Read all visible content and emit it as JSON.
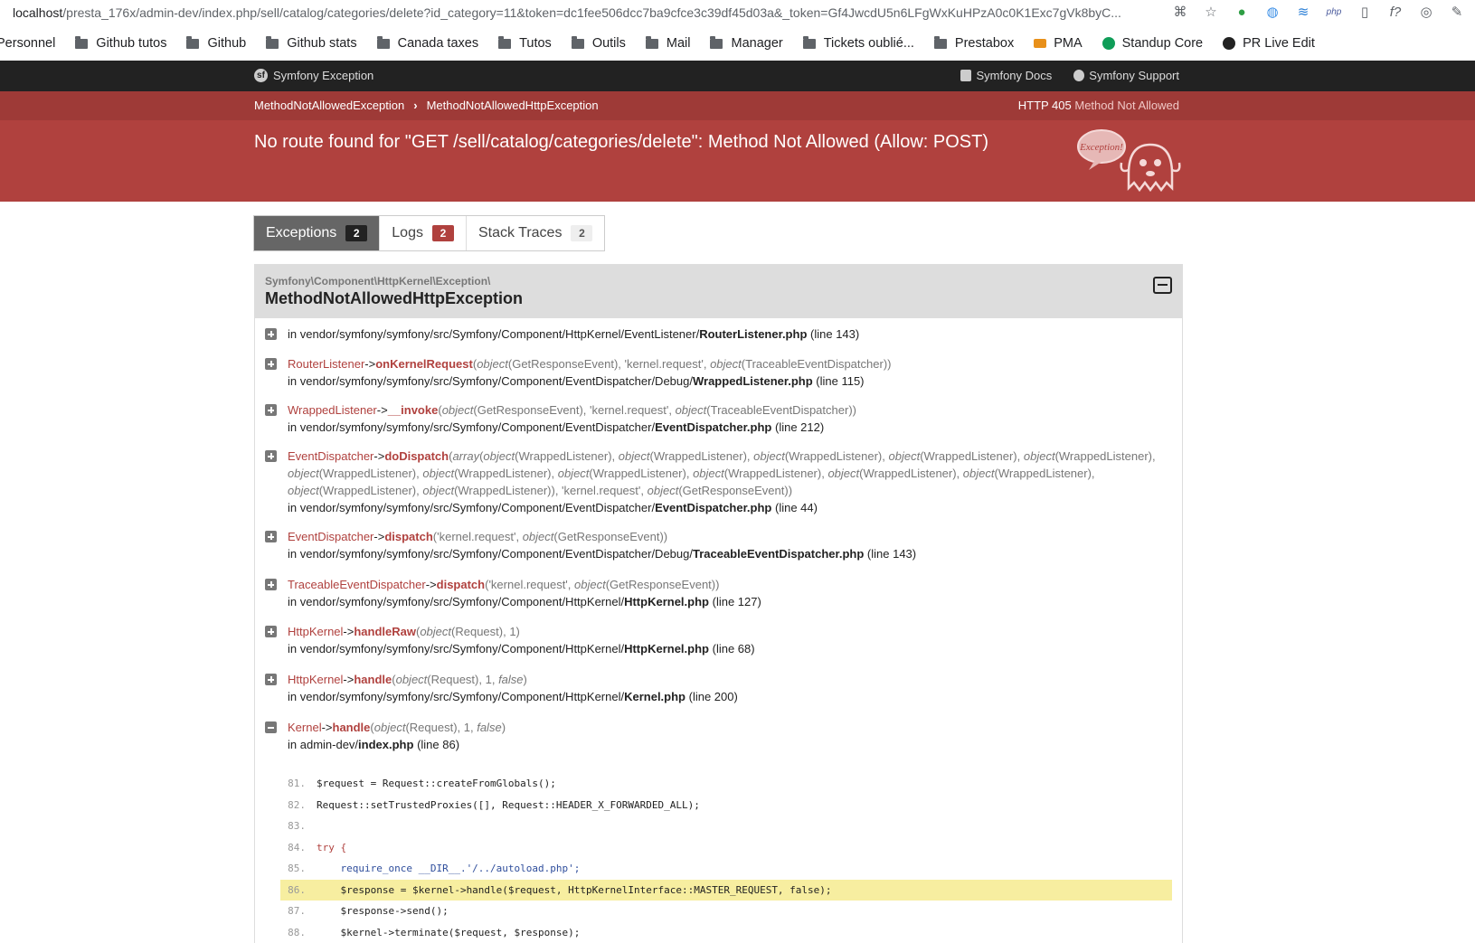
{
  "browser": {
    "url_host": "localhost",
    "url_rest": "/presta_176x/admin-dev/index.php/sell/catalog/categories/delete?id_category=11&token=dc1fee506dcc7ba9cfce3c39df45d03a&_token=Gf4JwcdU5n6LFgWxKuHPzA0c0K1Exc7gVk8byC...",
    "bookmarks": [
      "Personnel",
      "Github tutos",
      "Github",
      "Github stats",
      "Canada taxes",
      "Tutos",
      "Outils",
      "Mail",
      "Manager",
      "Tickets oublié...",
      "Prestabox",
      "PMA",
      "Standup Core",
      "PR Live Edit"
    ]
  },
  "header": {
    "brand": "Symfony Exception",
    "docs": "Symfony Docs",
    "support": "Symfony Support"
  },
  "band": {
    "crumb1": "MethodNotAllowedException",
    "crumb2": "MethodNotAllowedHttpException",
    "status_code": "HTTP 405",
    "status_text": "Method Not Allowed",
    "message": "No route found for \"GET /sell/catalog/categories/delete\": Method Not Allowed (Allow: POST)",
    "ghost_label": "Exception!"
  },
  "tabs": [
    {
      "label": "Exceptions",
      "count": "2"
    },
    {
      "label": "Logs",
      "count": "2"
    },
    {
      "label": "Stack Traces",
      "count": "2"
    }
  ],
  "exception": {
    "namespace": "Symfony\\Component\\HttpKernel\\Exception\\",
    "class": "MethodNotAllowedHttpException"
  },
  "frames": {
    "f0_file": "in vendor/symfony/symfony/src/Symfony/Component/HttpKernel/EventListener/",
    "f0_fileb": "RouterListener.php",
    "f0_line": "(line 143)",
    "f1_class": "RouterListener",
    "f1_method": "onKernelRequest",
    "f1_file": "in vendor/symfony/symfony/src/Symfony/Component/EventDispatcher/Debug/",
    "f1_fileb": "WrappedListener.php",
    "f1_line": "(line 115)",
    "f2_class": "WrappedListener",
    "f2_method": "__invoke",
    "f2_file": "in vendor/symfony/symfony/src/Symfony/Component/EventDispatcher/",
    "f2_fileb": "EventDispatcher.php",
    "f2_line": "(line 212)",
    "f3_class": "EventDispatcher",
    "f3_method": "doDispatch",
    "f3_file": "in vendor/symfony/symfony/src/Symfony/Component/EventDispatcher/",
    "f3_fileb": "EventDispatcher.php",
    "f3_line": "(line 44)",
    "f4_class": "EventDispatcher",
    "f4_method": "dispatch",
    "f4_file": "in vendor/symfony/symfony/src/Symfony/Component/EventDispatcher/Debug/",
    "f4_fileb": "TraceableEventDispatcher.php",
    "f4_line": "(line 143)",
    "f5_class": "TraceableEventDispatcher",
    "f5_method": "dispatch",
    "f5_file": "in vendor/symfony/symfony/src/Symfony/Component/HttpKernel/",
    "f5_fileb": "HttpKernel.php",
    "f5_line": "(line 127)",
    "f6_class": "HttpKernel",
    "f6_method": "handleRaw",
    "f6_file": "in vendor/symfony/symfony/src/Symfony/Component/HttpKernel/",
    "f6_fileb": "HttpKernel.php",
    "f6_line": "(line 68)",
    "f7_class": "HttpKernel",
    "f7_method": "handle",
    "f7_file": "in vendor/symfony/symfony/src/Symfony/Component/HttpKernel/",
    "f7_fileb": "Kernel.php",
    "f7_line": "(line 200)",
    "f8_class": "Kernel",
    "f8_method": "handle",
    "f8_file": "in admin-dev/",
    "f8_fileb": "index.php",
    "f8_line": "(line 86)"
  },
  "code_lines": [
    {
      "n": "81.",
      "t": "$request = Request::createFromGlobals();"
    },
    {
      "n": "82.",
      "t": "Request::setTrustedProxies([], Request::HEADER_X_FORWARDED_ALL);"
    },
    {
      "n": "83.",
      "t": ""
    },
    {
      "n": "84.",
      "t": "try {"
    },
    {
      "n": "85.",
      "t": "    require_once __DIR__.'/../autoload.php';"
    },
    {
      "n": "86.",
      "t": "    $response = $kernel->handle($request, HttpKernelInterface::MASTER_REQUEST, false);"
    },
    {
      "n": "87.",
      "t": "    $response->send();"
    },
    {
      "n": "88.",
      "t": "    $kernel->terminate($request, $response);"
    }
  ]
}
